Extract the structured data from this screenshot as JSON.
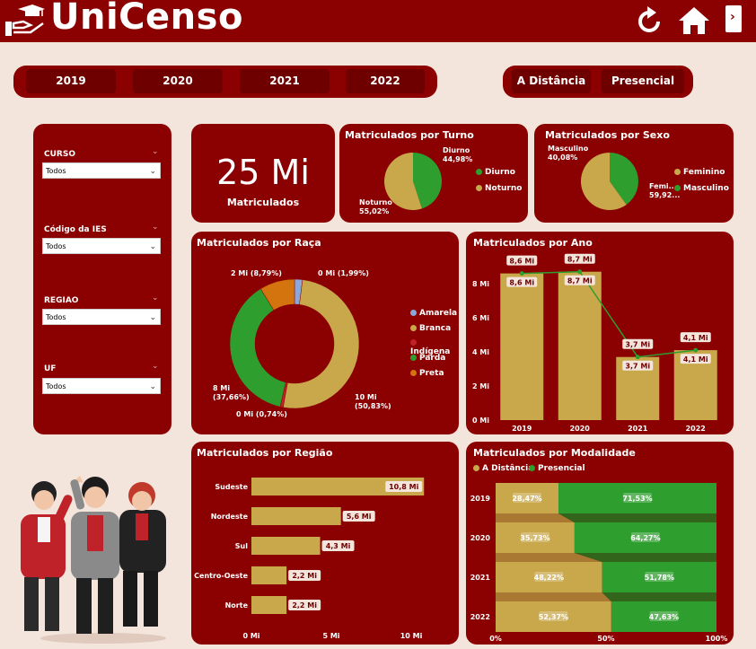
{
  "app": {
    "title": "UniCenso"
  },
  "year_filters": [
    "2019",
    "2020",
    "2021",
    "2022"
  ],
  "mode_filters": [
    "A Distância",
    "Presencial"
  ],
  "filters": [
    {
      "label": "CURSO",
      "value": "Todos"
    },
    {
      "label": "Código da IES",
      "value": "Todos"
    },
    {
      "label": "REGIAO",
      "value": "Todos"
    },
    {
      "label": "UF",
      "value": "Todos"
    }
  ],
  "kpi": {
    "value": "25 Mi",
    "label": "Matriculados"
  },
  "colors": {
    "gold": "#c9a84c",
    "green": "#2e9e2e",
    "dark_red": "#8b0000",
    "orange": "#d4740f",
    "blue": "#8aa8d8",
    "red": "#c0222a"
  },
  "chart_data": [
    {
      "id": "turno",
      "type": "pie",
      "title": "Matriculados por Turno",
      "slices": [
        {
          "name": "Diurno",
          "value": 44.98,
          "label": "Diurno\n44,98%",
          "color": "#2e9e2e"
        },
        {
          "name": "Noturno",
          "value": 55.02,
          "label": "Noturno\n55,02%",
          "color": "#c9a84c"
        }
      ],
      "legend": [
        "Diurno",
        "Noturno"
      ]
    },
    {
      "id": "sexo",
      "type": "pie",
      "title": "Matriculados por Sexo",
      "slices": [
        {
          "name": "Masculino",
          "value": 40.08,
          "label": "Masculino\n40,08%",
          "color": "#2e9e2e"
        },
        {
          "name": "Feminino",
          "value": 59.92,
          "label": "Femi...\n59,92...",
          "color": "#c9a84c"
        }
      ],
      "legend": [
        "Feminino",
        "Masculino"
      ]
    },
    {
      "id": "raca",
      "type": "pie",
      "title": "Matriculados por Raça",
      "slices": [
        {
          "name": "Amarela",
          "value": 1.99,
          "label": "0 Mi (1,99%)",
          "color": "#8aa8d8"
        },
        {
          "name": "Branca",
          "value": 50.83,
          "label": "10 Mi\n(50,83%)",
          "color": "#c9a84c"
        },
        {
          "name": "Indígena",
          "value": 0.74,
          "label": "0 Mi (0,74%)",
          "color": "#c0222a"
        },
        {
          "name": "Parda",
          "value": 37.66,
          "label": "8 Mi\n(37,66%)",
          "color": "#2e9e2e"
        },
        {
          "name": "Preta",
          "value": 8.79,
          "label": "2 Mi (8,79%)",
          "color": "#d4740f"
        }
      ],
      "legend": [
        "Amarela",
        "Branca",
        "Indígena",
        "Parda",
        "Preta"
      ]
    },
    {
      "id": "ano",
      "type": "bar",
      "title": "Matriculados por Ano",
      "categories": [
        "2019",
        "2020",
        "2021",
        "2022"
      ],
      "values": [
        8.6,
        8.7,
        3.7,
        4.1
      ],
      "labels": [
        "8,6 Mi",
        "8,7 Mi",
        "3,7 Mi",
        "4,1 Mi"
      ],
      "ylim": [
        0,
        8
      ],
      "yticks": [
        "0 Mi",
        "2 Mi",
        "4 Mi",
        "6 Mi",
        "8 Mi"
      ]
    },
    {
      "id": "regiao",
      "type": "bar",
      "orientation": "horizontal",
      "title": "Matriculados por Região",
      "categories": [
        "Sudeste",
        "Nordeste",
        "Sul",
        "Centro-Oeste",
        "Norte"
      ],
      "values": [
        10.8,
        5.6,
        4.3,
        2.2,
        2.2
      ],
      "labels": [
        "10,8 Mi",
        "5,6 Mi",
        "4,3 Mi",
        "2,2 Mi",
        "2,2 Mi"
      ],
      "xlim": [
        0,
        10
      ],
      "xticks": [
        "0 Mi",
        "5 Mi",
        "10 Mi"
      ]
    },
    {
      "id": "modalidade",
      "type": "bar",
      "stacked": "percent",
      "title": "Matriculados por Modalidade",
      "categories": [
        "2019",
        "2020",
        "2021",
        "2022"
      ],
      "series": [
        {
          "name": "A Distância",
          "values": [
            28.47,
            35.73,
            48.22,
            52.37
          ],
          "labels": [
            "28,47%",
            "35,73%",
            "48,22%",
            "52,37%"
          ]
        },
        {
          "name": "Presencial",
          "values": [
            71.53,
            64.27,
            51.78,
            47.63
          ],
          "labels": [
            "71,53%",
            "64,27%",
            "51,78%",
            "47,63%"
          ]
        }
      ],
      "xticks": [
        "0%",
        "50%",
        "100%"
      ]
    }
  ]
}
